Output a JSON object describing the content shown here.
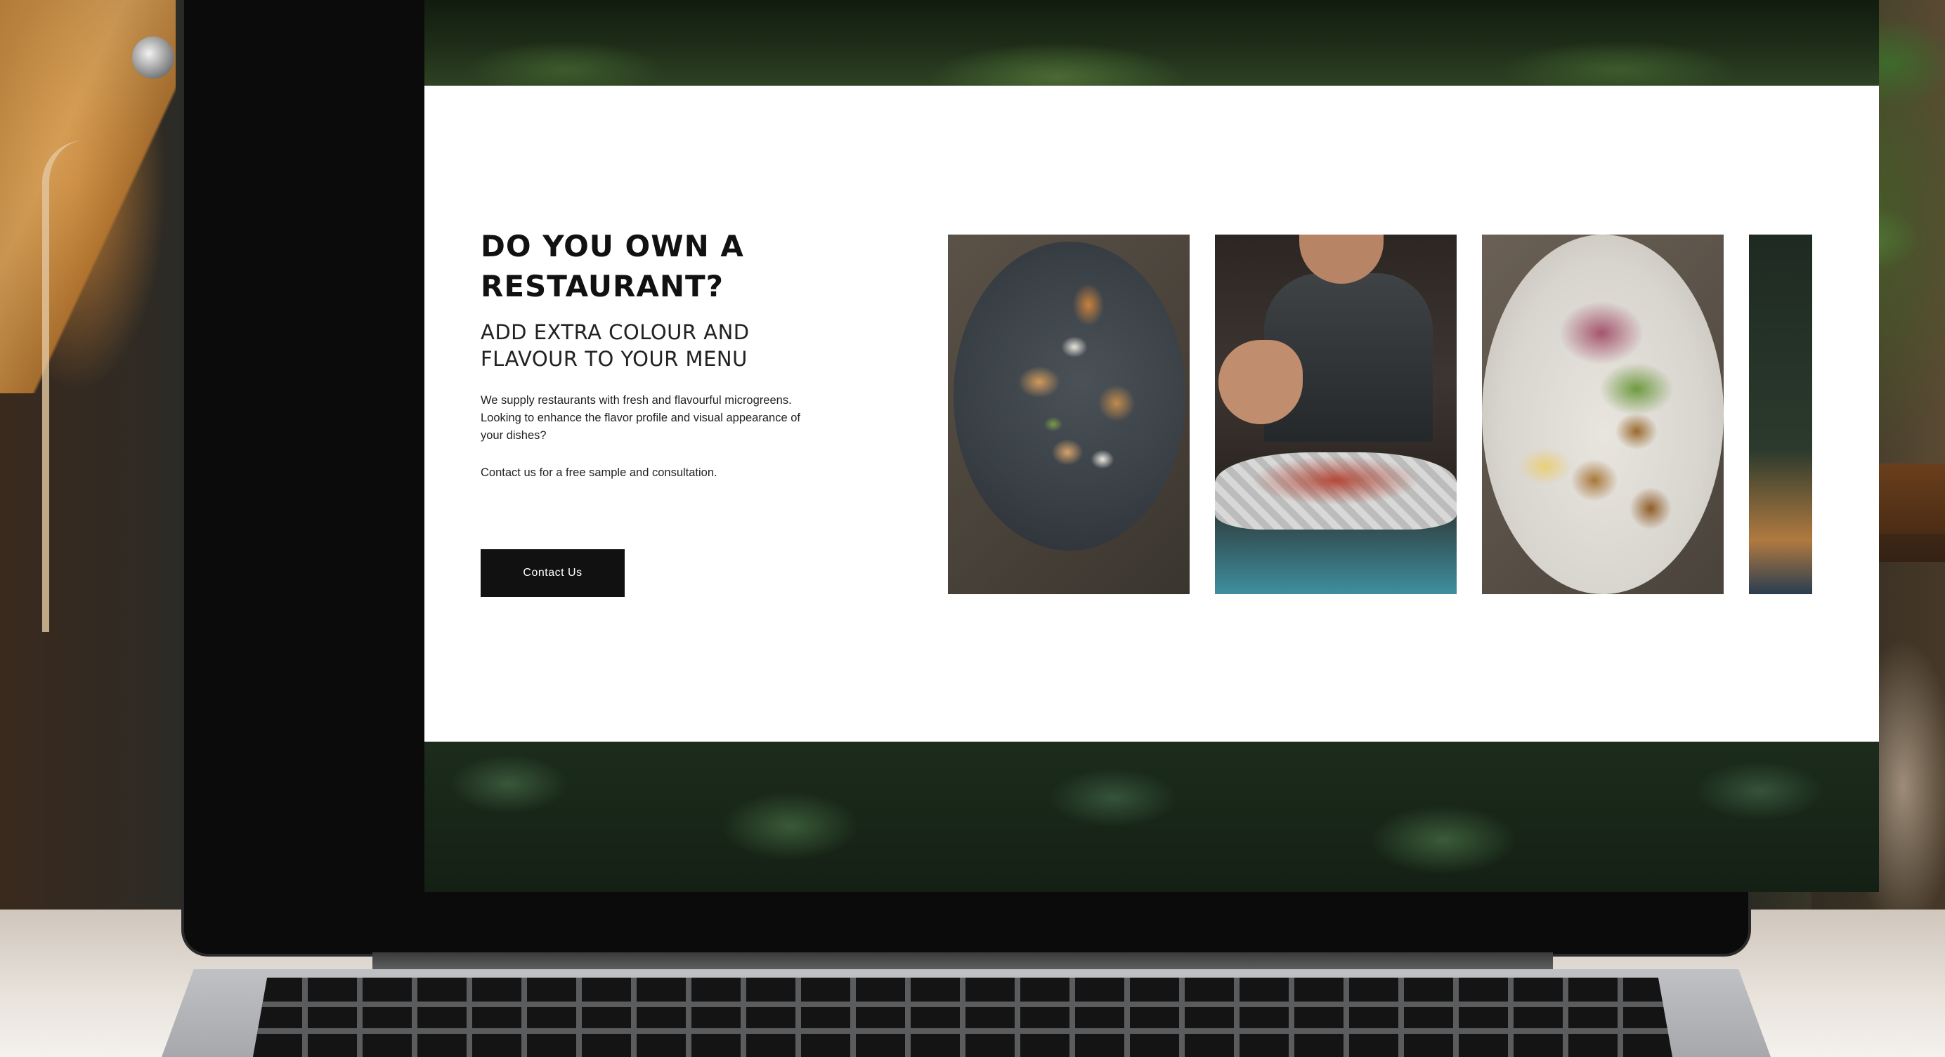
{
  "restaurant_section": {
    "heading_line1": "DO YOU OWN A",
    "heading_line2": "RESTAURANT?",
    "subheading_line1": "ADD EXTRA COLOUR AND",
    "subheading_line2": "FLAVOUR TO YOUR MENU",
    "body_line1": "We supply restaurants with fresh and flavourful microgreens.",
    "body_line2": "Looking to enhance the flavor profile and visual appearance of",
    "body_line3": "your dishes?",
    "cta_text": "Contact us for a free sample and consultation.",
    "contact_button_label": "Contact Us"
  },
  "gallery": {
    "photos": [
      {
        "icon": "plated-dish-photo"
      },
      {
        "icon": "chef-garnishing-photo"
      },
      {
        "icon": "salad-bowl-photo"
      },
      {
        "icon": "restaurant-interior-photo"
      }
    ]
  },
  "colors": {
    "button_background": "#111111",
    "button_text": "#ffffff",
    "section_background": "#ffffff",
    "heading_text": "#111111"
  }
}
